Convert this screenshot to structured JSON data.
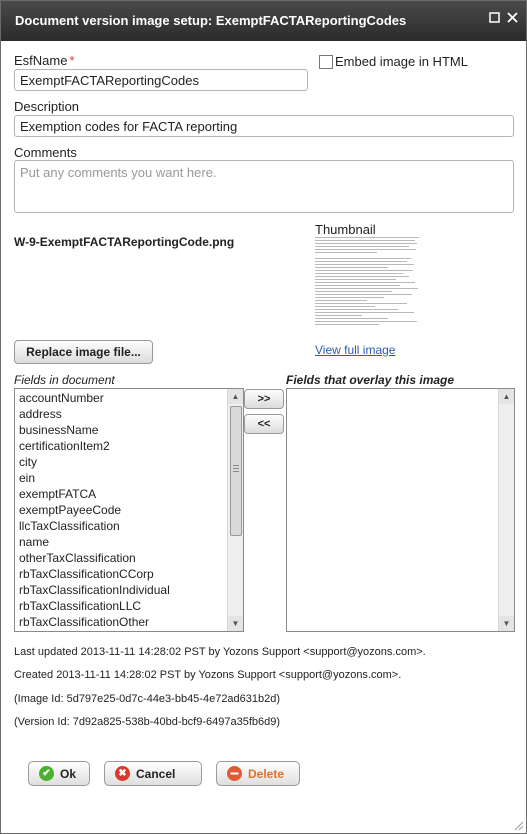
{
  "window": {
    "title": "Document version image setup: ExemptFACTAReportingCodes"
  },
  "form": {
    "esfname_label": "EsfName",
    "esfname_required": "*",
    "esfname_value": "ExemptFACTAReportingCodes",
    "embed_label": "Embed image in HTML",
    "embed_checked": false,
    "description_label": "Description",
    "description_value": "Exemption codes for FACTA reporting",
    "comments_label": "Comments",
    "comments_placeholder": "Put any comments you want here."
  },
  "image": {
    "filename": "W-9-ExemptFACTAReportingCode.png",
    "thumbnail_label": "Thumbnail",
    "view_link": "View full image",
    "replace_button": "Replace image file..."
  },
  "fields": {
    "left_label": "Fields in document",
    "right_label": "Fields that overlay this image",
    "move_right": ">>",
    "move_left": "<<",
    "document_fields": [
      "accountNumber",
      "address",
      "businessName",
      "certificationItem2",
      "city",
      "ein",
      "exemptFATCA",
      "exemptPayeeCode",
      "llcTaxClassification",
      "name",
      "otherTaxClassification",
      "rbTaxClassificationCCorp",
      "rbTaxClassificationIndividual",
      "rbTaxClassificationLLC",
      "rbTaxClassificationOther"
    ],
    "overlay_fields": []
  },
  "meta": {
    "last_updated": "Last updated 2013-11-11 14:28:02 PST by Yozons Support <support@yozons.com>.",
    "created": "Created 2013-11-11 14:28:02 PST by Yozons Support <support@yozons.com>.",
    "image_id": "(Image Id: 5d797e25-0d7c-44e3-bb45-4e72ad631b2d)",
    "version_id": "(Version Id: 7d92a825-538b-40bd-bcf9-6497a35fb6d9)"
  },
  "buttons": {
    "ok": "Ok",
    "cancel": "Cancel",
    "delete": "Delete"
  },
  "colors": {
    "ok_icon": "#4caf2e",
    "cancel_icon": "#d93a2e",
    "delete_icon": "#e05a35",
    "delete_text": "#e0732c",
    "link": "#2a5db0"
  }
}
